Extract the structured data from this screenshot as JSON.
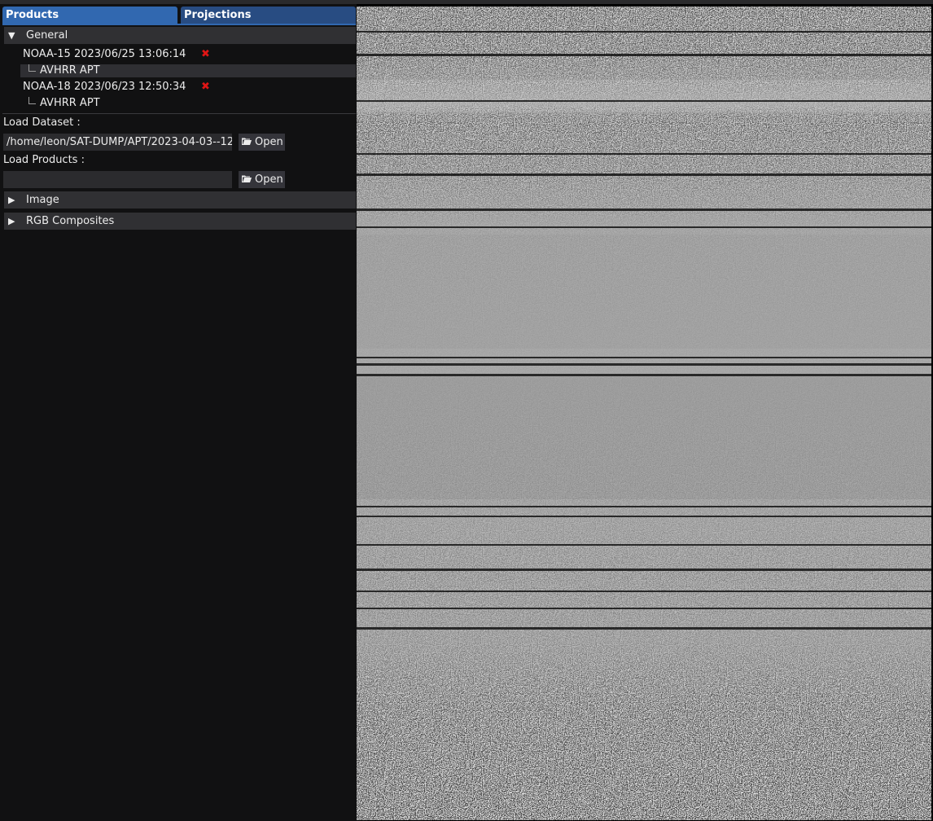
{
  "tabs": {
    "products": "Products",
    "projections": "Projections"
  },
  "general": {
    "header": "General",
    "expanded": true,
    "products": [
      {
        "name": "NOAA-15 2023/06/25 13:06:14",
        "child": "AVHRR APT",
        "selected": true
      },
      {
        "name": "NOAA-18 2023/06/23 12:50:34",
        "child": "AVHRR APT",
        "selected": false
      }
    ]
  },
  "load_dataset": {
    "label": "Load Dataset :",
    "value": "/home/leon/SAT-DUMP/APT/2023-04-03--12",
    "button": "Open"
  },
  "load_products": {
    "label": "Load Products :",
    "value": "",
    "button": "Open"
  },
  "sections": [
    {
      "label": "Image",
      "expanded": false
    },
    {
      "label": "RGB Composites",
      "expanded": false
    }
  ],
  "icons": {
    "remove": "x-mark-icon",
    "folder": "folder-open-icon",
    "expanded_arrow": "triangle-down-icon",
    "collapsed_arrow": "triangle-right-icon"
  },
  "colors": {
    "tab_active": "#3168b0",
    "tab_inactive": "#284c82",
    "remove_icon": "#e01515",
    "panel_bg": "#111112",
    "header_bg": "#303033"
  }
}
